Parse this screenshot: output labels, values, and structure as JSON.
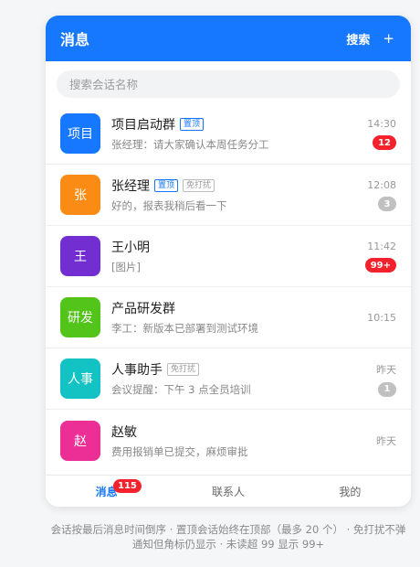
{
  "header": {
    "title": "消息",
    "search_label": "搜索",
    "plus_label": "+"
  },
  "search": {
    "placeholder": "搜索会话名称"
  },
  "conversations": [
    {
      "avatar_text": "项目",
      "avatar_color": "#1677ff",
      "name": "项目启动群",
      "tags": [
        "置顶"
      ],
      "preview": "张经理：请大家确认本周任务分工",
      "time": "14:30",
      "badge": "12",
      "badge_style": "red"
    },
    {
      "avatar_text": "张",
      "avatar_color": "#fa8c16",
      "name": "张经理",
      "tags": [
        "置顶",
        "免打扰"
      ],
      "preview": "好的，报表我稍后看一下",
      "time": "12:08",
      "badge": "3",
      "badge_style": "gray"
    },
    {
      "avatar_text": "王",
      "avatar_color": "#722ed1",
      "name": "王小明",
      "tags": [],
      "preview": "[图片]",
      "time": "11:42",
      "badge": "99+",
      "badge_style": "red"
    },
    {
      "avatar_text": "研发",
      "avatar_color": "#52c41a",
      "name": "产品研发群",
      "tags": [],
      "preview": "李工：新版本已部署到测试环境",
      "time": "10:15",
      "badge": "",
      "badge_style": ""
    },
    {
      "avatar_text": "人事",
      "avatar_color": "#13c2c2",
      "name": "人事助手",
      "tags": [
        "免打扰"
      ],
      "preview": "会议提醒：下午 3 点全员培训",
      "time": "昨天",
      "badge": "1",
      "badge_style": "gray"
    },
    {
      "avatar_text": "赵",
      "avatar_color": "#eb2f96",
      "name": "赵敏",
      "tags": [],
      "preview": "费用报销单已提交，麻烦审批",
      "time": "昨天",
      "badge": "",
      "badge_style": ""
    }
  ],
  "tabbar": {
    "tabs": [
      {
        "label": "消息",
        "badge": "115"
      },
      {
        "label": "联系人"
      },
      {
        "label": "我的"
      }
    ]
  },
  "footer_note": "会话按最后消息时间倒序 · 置顶会话始终在顶部（最多 20 个） · 免打扰不弹通知但角标仍显示 · 未读超 99 显示 99+"
}
